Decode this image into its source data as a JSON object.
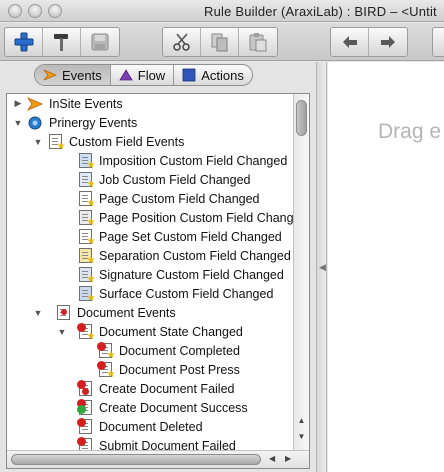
{
  "window": {
    "title": "Rule Builder (AraxiLab) : BIRD – <Untit"
  },
  "toolbar": {
    "left_group": [
      {
        "name": "new-rule-button",
        "icon": "plus-icon"
      },
      {
        "name": "build-button",
        "icon": "hammer-icon"
      },
      {
        "name": "save-button",
        "icon": "save-icon"
      }
    ],
    "edit_group": [
      {
        "name": "cut-button",
        "icon": "scissors-icon"
      },
      {
        "name": "copy-button",
        "icon": "copy-icon"
      },
      {
        "name": "paste-button",
        "icon": "paste-icon"
      }
    ],
    "history_group": [
      {
        "name": "undo-button",
        "icon": "undo-arrow-icon"
      },
      {
        "name": "redo-button",
        "icon": "redo-arrow-icon"
      }
    ]
  },
  "tabs": {
    "events": "Events",
    "flow": "Flow",
    "actions": "Actions",
    "active": "events"
  },
  "tree": {
    "insite_events": "InSite Events",
    "prinergy_events": "Prinergy Events",
    "custom_field_events": "Custom Field Events",
    "imposition_cf": "Imposition Custom Field Changed",
    "job_cf": "Job Custom Field Changed",
    "page_cf": "Page Custom Field Changed",
    "page_position_cf": "Page Position Custom Field Chang",
    "page_set_cf": "Page Set Custom Field Changed",
    "separation_cf": "Separation Custom Field Changed",
    "signature_cf": "Signature Custom Field Changed",
    "surface_cf": "Surface Custom Field Changed",
    "document_events": "Document Events",
    "document_state_changed": "Document State Changed",
    "document_completed": "Document Completed",
    "document_post_press": "Document Post Press",
    "create_document_failed": "Create Document Failed",
    "create_document_success": "Create Document Success",
    "document_deleted": "Document Deleted",
    "submit_document_failed": "Submit Document Failed"
  },
  "canvas": {
    "hint": "Drag e"
  },
  "colors": {
    "events_arrow": "#f39a12",
    "flow_triangle": "#7b3fb5",
    "actions_square": "#2f55b8",
    "accent_blue": "#1f5fbf"
  }
}
